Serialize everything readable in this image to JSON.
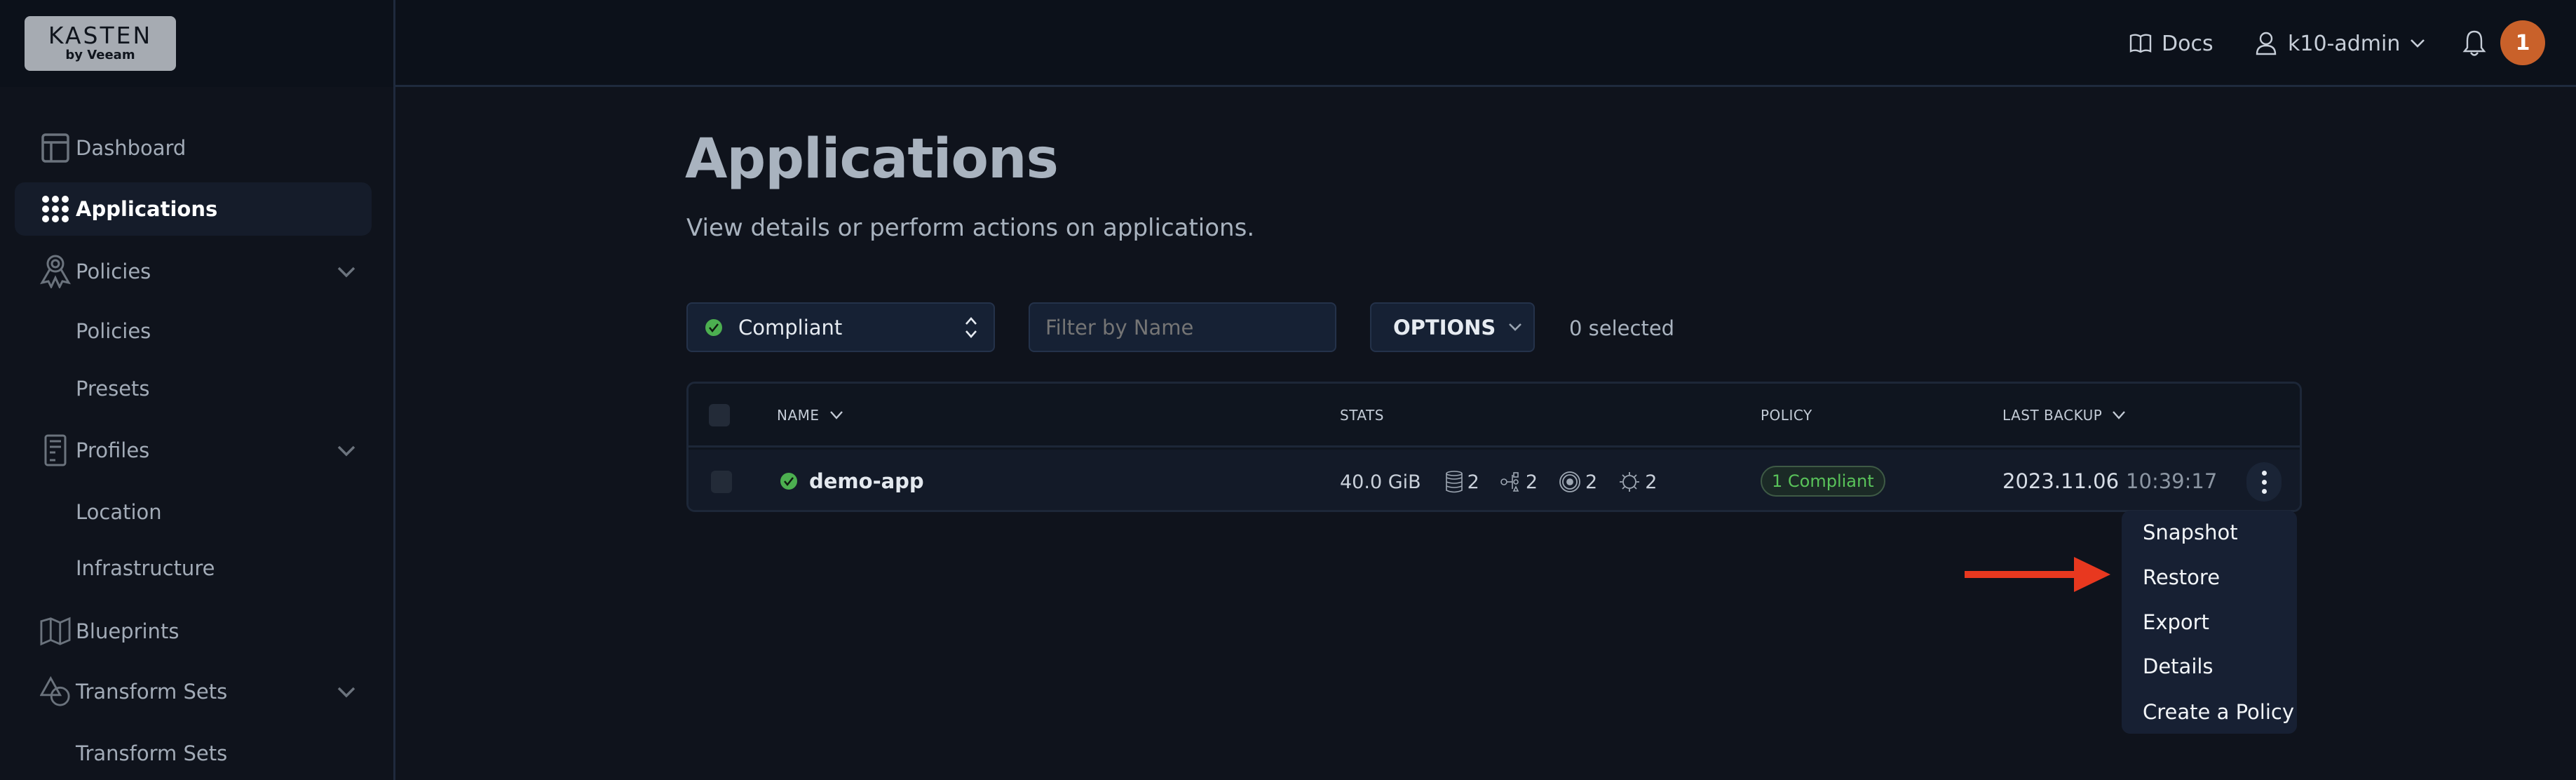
{
  "brand": {
    "name": "KASTEN",
    "sub": "by Veeam"
  },
  "header": {
    "docs_label": "Docs",
    "user_label": "k10-admin",
    "notification_count": "1",
    "badge_color": "#c9612a"
  },
  "sidebar": {
    "items": [
      {
        "label": "Dashboard",
        "icon": "dashboard-icon",
        "active": false
      },
      {
        "label": "Applications",
        "icon": "apps-grid-icon",
        "active": true
      },
      {
        "label": "Policies",
        "icon": "ribbon-icon",
        "expandable": true
      },
      {
        "label": "Policies",
        "sub": true
      },
      {
        "label": "Presets",
        "sub": true
      },
      {
        "label": "Profiles",
        "icon": "profile-doc-icon",
        "expandable": true
      },
      {
        "label": "Location",
        "sub": true
      },
      {
        "label": "Infrastructure",
        "sub": true
      },
      {
        "label": "Blueprints",
        "icon": "map-icon"
      },
      {
        "label": "Transform Sets",
        "icon": "shapes-icon",
        "expandable": true
      },
      {
        "label": "Transform Sets",
        "sub": true
      }
    ]
  },
  "main": {
    "title": "Applications",
    "subtitle": "View details or perform actions on applications.",
    "filter_select": {
      "value": "Compliant"
    },
    "name_filter": {
      "placeholder": "Filter by Name",
      "value": ""
    },
    "options_label": "OPTIONS",
    "selected_count": "0 selected"
  },
  "table": {
    "columns": [
      "NAME",
      "STATS",
      "POLICY",
      "LAST BACKUP"
    ],
    "rows": [
      {
        "name": "demo-app",
        "status": "compliant",
        "size": "40.0 GiB",
        "volumes": "2",
        "workloads": "2",
        "services": "2",
        "configs": "2",
        "policy": "1 Compliant",
        "backup_date": "2023.11.06",
        "backup_time": "10:39:17"
      }
    ]
  },
  "row_menu": {
    "items": [
      "Snapshot",
      "Restore",
      "Export",
      "Details",
      "Create a Policy"
    ],
    "highlighted": "Restore"
  },
  "colors": {
    "accent_green": "#4caf50",
    "annotation_arrow": "#e8381f"
  }
}
